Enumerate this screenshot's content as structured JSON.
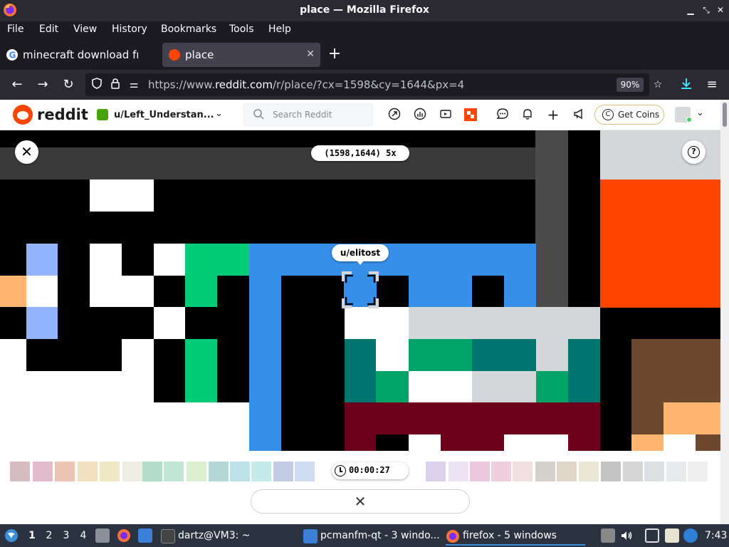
{
  "window": {
    "title": "place — Mozilla Firefox"
  },
  "menu": [
    "File",
    "Edit",
    "View",
    "History",
    "Bookmarks",
    "Tools",
    "Help"
  ],
  "tabs": [
    {
      "label": "minecraft download free",
      "active": false
    },
    {
      "label": "place",
      "active": true
    }
  ],
  "nav": {
    "url_prefix": "https://www.",
    "url_domain": "reddit.com",
    "url_path": "/r/place/?cx=1598&cy=1644&px=4",
    "zoom": "90%"
  },
  "reddit": {
    "logo_text": "reddit",
    "community": "u/Left_Understan...",
    "search_placeholder": "Search Reddit",
    "coins_label": "Get Coins",
    "coins_glyph": "C"
  },
  "place": {
    "coordinates": "(1598,1644) 5x",
    "hovered_user": "u/elitost",
    "timer": "00:00:27",
    "help_glyph": "?"
  },
  "taskbar": {
    "workspaces": [
      "1",
      "2",
      "3",
      "4"
    ],
    "tasks": [
      {
        "label": "dartz@VM3: ~"
      },
      {
        "label": "pcmanfm-qt - 3 windo..."
      },
      {
        "label": "firefox - 5 windows"
      }
    ],
    "clock": "7:43"
  },
  "colors": {
    "accent": "#ff4500",
    "firefox_dark": "#1c1b22",
    "taskbar": "#2c3340",
    "place_blue": "#3690ea",
    "place_green": "#00cc78",
    "place_teal": "#00756f",
    "place_burgundy": "#6d001a",
    "place_orange": "#ff4500",
    "place_brown": "#6d482f"
  }
}
